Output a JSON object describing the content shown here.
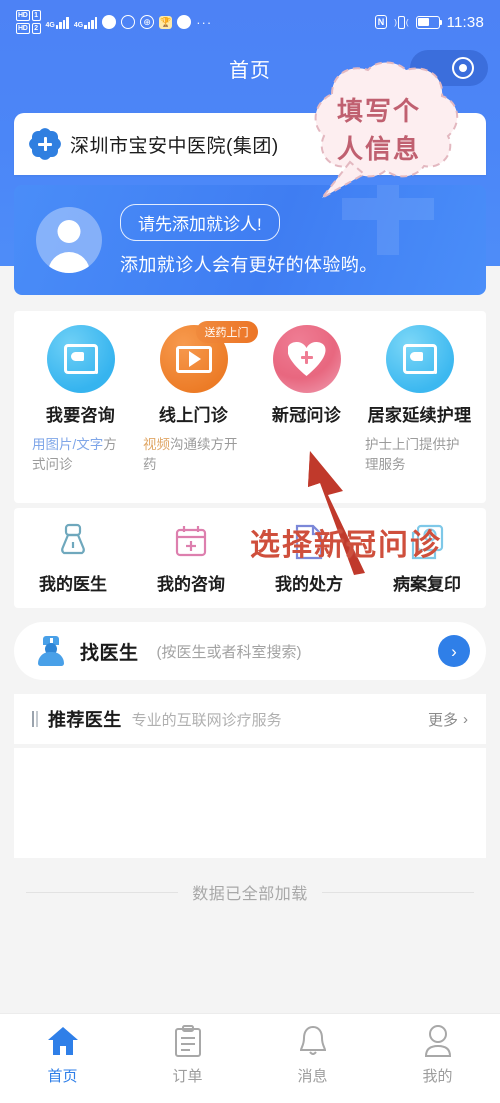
{
  "statusbar": {
    "hd1": "HD",
    "hd2": "HD",
    "sim1": "1",
    "sim2": "2",
    "net1": "4G",
    "net2": "4G",
    "overflow_dots": "···",
    "nfc": "N",
    "time": "11:38"
  },
  "navbar": {
    "title": "首页",
    "capsule_icon": "target-icon"
  },
  "hospital": {
    "name": "深圳市宝安中医院(集团)"
  },
  "patient_banner": {
    "pill_text": "请先添加就诊人!",
    "subtitle": "添加就诊人会有更好的体验哟。"
  },
  "services": {
    "items": [
      {
        "label": "我要咨询",
        "desc_a": "用图片/文字",
        "desc_b": "方式问诊",
        "badge": ""
      },
      {
        "label": "线上门诊",
        "desc_a": "视频",
        "desc_b": "沟通续方开药",
        "badge": "送药上门"
      },
      {
        "label": "新冠问诊",
        "desc_a": "",
        "desc_b": "",
        "badge": ""
      },
      {
        "label": "居家延续护理",
        "desc_a": "护士上门提供护",
        "desc_b": "理服务",
        "badge": ""
      }
    ]
  },
  "tools": {
    "items": [
      {
        "label": "我的医生"
      },
      {
        "label": "我的咨询"
      },
      {
        "label": "我的处方"
      },
      {
        "label": "病案复印"
      }
    ]
  },
  "find_doctor": {
    "title": "找医生",
    "subtitle": "(按医生或者科室搜索)",
    "arrow": "›"
  },
  "recommend": {
    "title": "推荐医生",
    "subtitle": "专业的互联网诊疗服务",
    "more": "更多",
    "chevron": "›"
  },
  "footer": {
    "loaded_text": "数据已全部加载"
  },
  "tabbar": {
    "items": [
      {
        "label": "首页",
        "icon": "home-icon",
        "active": true
      },
      {
        "label": "订单",
        "icon": "clipboard-icon",
        "active": false
      },
      {
        "label": "消息",
        "icon": "bell-icon",
        "active": false
      },
      {
        "label": "我的",
        "icon": "person-icon",
        "active": false
      }
    ]
  },
  "annotations": {
    "cloud_line1": "填写个",
    "cloud_line2": "人信息",
    "arrow_label": "选择新冠问诊"
  },
  "colors": {
    "brand_blue": "#4d82f5",
    "accent_blue": "#2f7fe8",
    "annotation_red": "#cf4f3c",
    "cloud_pink": "#c06070",
    "badge_orange": "#ec7526"
  }
}
